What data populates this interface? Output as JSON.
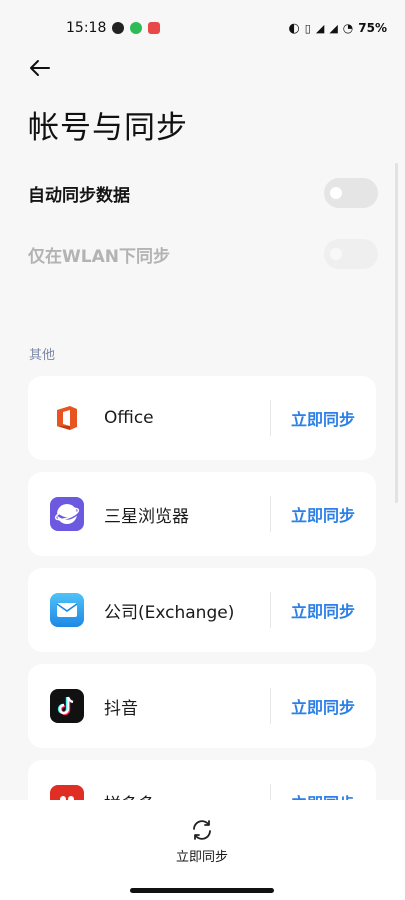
{
  "status_bar": {
    "time": "15:18",
    "battery": "75%"
  },
  "page": {
    "title": "帐号与同步"
  },
  "settings": {
    "auto_sync_label": "自动同步数据",
    "auto_sync_on": false,
    "wlan_only_label": "仅在WLAN下同步",
    "wlan_only_on": false,
    "wlan_only_enabled": false
  },
  "section": {
    "other_label": "其他"
  },
  "accounts": [
    {
      "name": "Office",
      "action": "立即同步",
      "icon": "office-icon"
    },
    {
      "name": "三星浏览器",
      "action": "立即同步",
      "icon": "samsung-browser-icon"
    },
    {
      "name": "公司(Exchange)",
      "action": "立即同步",
      "icon": "exchange-mail-icon"
    },
    {
      "name": "抖音",
      "action": "立即同步",
      "icon": "douyin-icon"
    },
    {
      "name": "拼多多",
      "action": "立即同步",
      "icon": "pinduoduo-icon"
    }
  ],
  "bottom": {
    "sync_now_label": "立即同步",
    "icon": "sync-icon"
  }
}
